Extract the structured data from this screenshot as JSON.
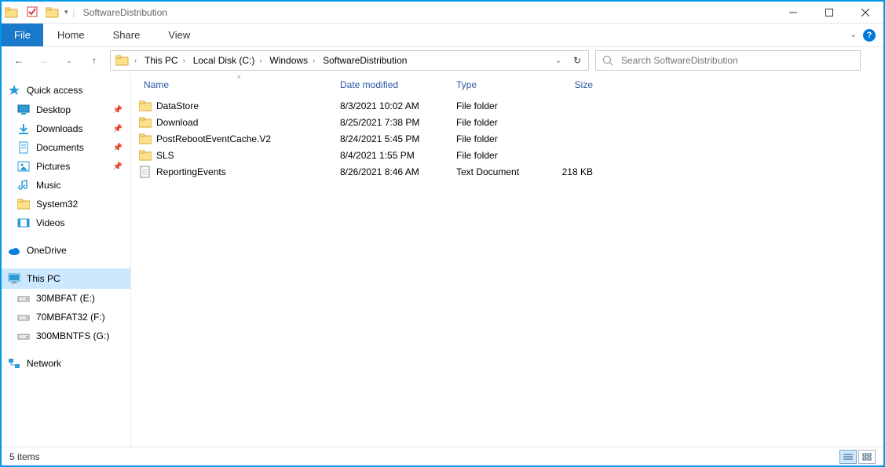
{
  "window": {
    "title": "SoftwareDistribution"
  },
  "ribbon": {
    "file": "File",
    "tabs": [
      "Home",
      "Share",
      "View"
    ]
  },
  "breadcrumb": [
    "This PC",
    "Local Disk (C:)",
    "Windows",
    "SoftwareDistribution"
  ],
  "search": {
    "placeholder": "Search SoftwareDistribution"
  },
  "nav": {
    "quick_access": "Quick access",
    "quick_items": [
      {
        "label": "Desktop",
        "icon": "desktop",
        "pinned": true
      },
      {
        "label": "Downloads",
        "icon": "downloads",
        "pinned": true
      },
      {
        "label": "Documents",
        "icon": "documents",
        "pinned": true
      },
      {
        "label": "Pictures",
        "icon": "pictures",
        "pinned": true
      },
      {
        "label": "Music",
        "icon": "music",
        "pinned": false
      },
      {
        "label": "System32",
        "icon": "folder",
        "pinned": false
      },
      {
        "label": "Videos",
        "icon": "videos",
        "pinned": false
      }
    ],
    "onedrive": "OneDrive",
    "thispc": "This PC",
    "drives": [
      {
        "label": "30MBFAT (E:)"
      },
      {
        "label": "70MBFAT32 (F:)"
      },
      {
        "label": "300MBNTFS (G:)"
      }
    ],
    "network": "Network"
  },
  "columns": {
    "name": "Name",
    "date": "Date modified",
    "type": "Type",
    "size": "Size"
  },
  "files": [
    {
      "name": "DataStore",
      "date": "8/3/2021 10:02 AM",
      "type": "File folder",
      "size": "",
      "icon": "folder"
    },
    {
      "name": "Download",
      "date": "8/25/2021 7:38 PM",
      "type": "File folder",
      "size": "",
      "icon": "folder"
    },
    {
      "name": "PostRebootEventCache.V2",
      "date": "8/24/2021 5:45 PM",
      "type": "File folder",
      "size": "",
      "icon": "folder"
    },
    {
      "name": "SLS",
      "date": "8/4/2021 1:55 PM",
      "type": "File folder",
      "size": "",
      "icon": "folder"
    },
    {
      "name": "ReportingEvents",
      "date": "8/26/2021 8:46 AM",
      "type": "Text Document",
      "size": "218 KB",
      "icon": "file"
    }
  ],
  "status": {
    "items": "5 items"
  }
}
